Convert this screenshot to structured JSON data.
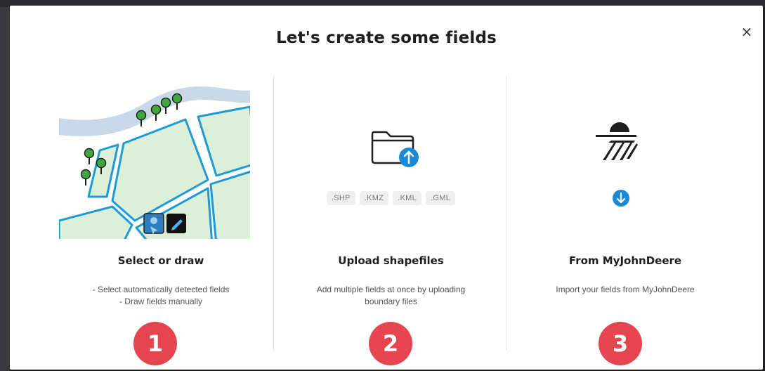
{
  "modal": {
    "title": "Let's create some fields",
    "close_label": "×"
  },
  "options": [
    {
      "title": "Select or draw",
      "description_lines": [
        "- Select automatically detected fields",
        "- Draw fields manually"
      ],
      "badge": "1"
    },
    {
      "title": "Upload shapefiles",
      "description_lines": [
        "Add multiple fields at once by uploading",
        "boundary files"
      ],
      "badge": "2",
      "file_types": [
        ".SHP",
        ".KMZ",
        ".KML",
        ".GML"
      ]
    },
    {
      "title": "From MyJohnDeere",
      "description_lines": [
        "Import your fields from MyJohnDeere"
      ],
      "badge": "3"
    }
  ],
  "colors": {
    "accent_blue": "#1a88d8",
    "field_green": "#dcefd8",
    "field_border": "#1e9ad6",
    "river": "#c9d9ea",
    "badge_red": "#e5454f"
  },
  "icons": {
    "option_1": [
      "map-illustration",
      "select-field-icon",
      "pencil-icon"
    ],
    "option_2": [
      "folder-icon",
      "upload-arrow-icon"
    ],
    "option_3": [
      "john-deere-field-icon",
      "download-arrow-icon"
    ]
  }
}
